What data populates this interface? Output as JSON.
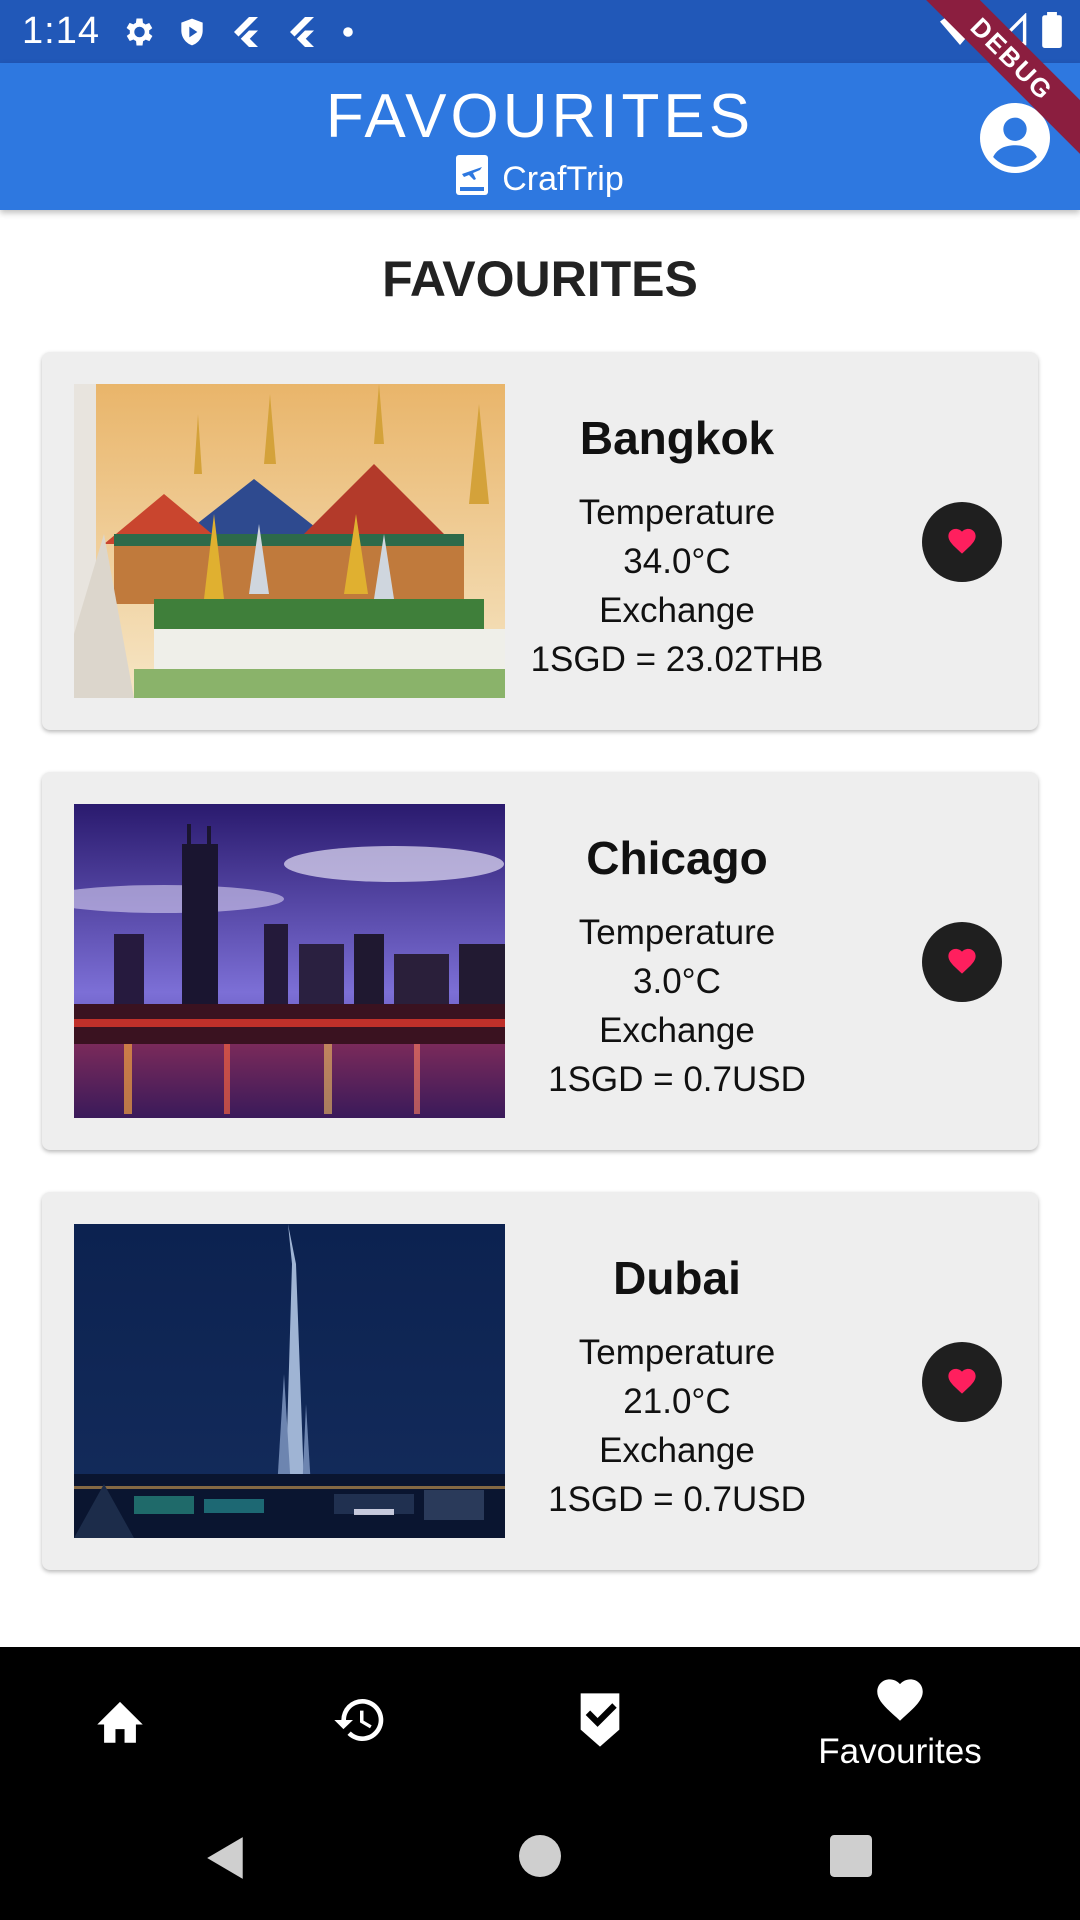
{
  "status_bar": {
    "time": "1:14",
    "icons_left": [
      "settings-icon",
      "shield-icon",
      "flutter-icon",
      "flutter-icon",
      "dot-icon"
    ],
    "icons_right": [
      "wifi-icon",
      "signal-icon",
      "battery-icon"
    ]
  },
  "debug_banner": "DEBUG",
  "app_bar": {
    "title": "FAVOURITES",
    "subtitle": "CrafTrip",
    "subtitle_icon": "flight-book-icon",
    "profile_icon": "account-circle-icon",
    "color": "#2e78e0"
  },
  "page": {
    "heading": "FAVOURITES"
  },
  "favourites": [
    {
      "city": "Bangkok",
      "temperature_label": "Temperature",
      "temperature_value": "34.0°C",
      "exchange_label": "Exchange",
      "exchange_value": "1SGD = 23.02THB",
      "image": "bangkok-grand-palace-image"
    },
    {
      "city": "Chicago",
      "temperature_label": "Temperature",
      "temperature_value": "3.0°C",
      "exchange_label": "Exchange",
      "exchange_value": "1SGD = 0.7USD",
      "image": "chicago-skyline-image"
    },
    {
      "city": "Dubai",
      "temperature_label": "Temperature",
      "temperature_value": "21.0°C",
      "exchange_label": "Exchange",
      "exchange_value": "1SGD = 0.7USD",
      "image": "dubai-burj-khalifa-image"
    }
  ],
  "favourite_icon_color": "#ff1f5e",
  "bottom_nav": {
    "items": [
      {
        "icon": "home-icon",
        "label": ""
      },
      {
        "icon": "history-icon",
        "label": ""
      },
      {
        "icon": "checklist-icon",
        "label": ""
      },
      {
        "icon": "heart-icon",
        "label": "Favourites",
        "selected": true
      }
    ]
  },
  "system_nav": [
    "back-icon",
    "home-circle-icon",
    "recents-icon"
  ]
}
